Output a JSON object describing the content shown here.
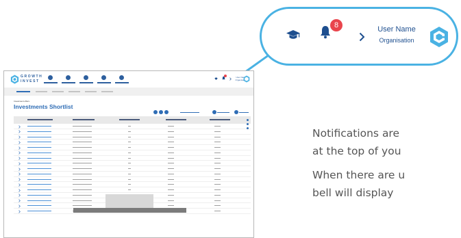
{
  "callout": {
    "badge_count": "8",
    "user_name": "User Name",
    "organisation": "Organisation",
    "icons": [
      "graduation-cap-icon",
      "bell-icon",
      "chevron-right-icon",
      "growth-invest-logo"
    ]
  },
  "monitor": {
    "brand_top": "GROWTH",
    "brand_bottom": "INVEST",
    "breadcrumb": "Investment offers",
    "page_title": "Investments Shortlist",
    "mini_badge": "8",
    "mini_user_name": "User Name",
    "mini_organisation": "Organisation"
  },
  "copy": {
    "line1": "Notifications are",
    "line2": "at the top of you",
    "line3": "When there are u",
    "line4": "bell will display"
  },
  "colors": {
    "accent_blue": "#4ab2e3",
    "brand_navy": "#1e4f8f",
    "badge_red": "#e9454d",
    "text_gray": "#555555"
  }
}
